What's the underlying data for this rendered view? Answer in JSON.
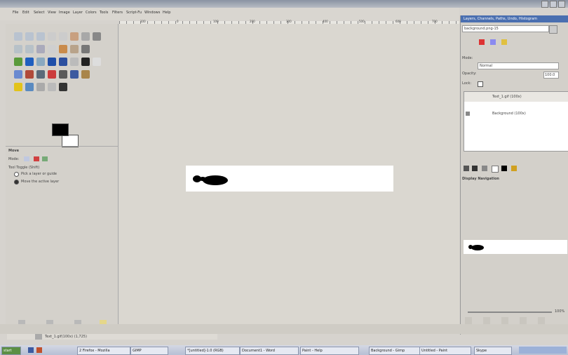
{
  "window": {
    "title": ""
  },
  "menubar": {
    "items": [
      "File",
      "Edit",
      "Select",
      "View",
      "Image",
      "Layer",
      "Colors",
      "Tools",
      "Filters",
      "Script-Fu",
      "Windows",
      "Help"
    ]
  },
  "ruler": {
    "ticks": [
      "100",
      "0",
      "100",
      "200",
      "300",
      "400",
      "500",
      "600",
      "700",
      "800"
    ]
  },
  "toolbox": {
    "options_title": "Move",
    "mode_label": "Mode:",
    "tool_toggle_label": "Tool Toggle (Shift)",
    "option_1": "Pick a layer or guide",
    "option_2": "Move the active layer"
  },
  "dock": {
    "tabs_label": "Layers, Channels, Paths, Undo, Histogram",
    "image_select": "background.png-15",
    "mode_label": "Mode:",
    "mode_value": "Normal",
    "opacity_label": "Opacity:",
    "opacity_value": "100.0",
    "lock_label": "Lock:",
    "layers": [
      {
        "name": "Text_1.gif (100x)"
      },
      {
        "name": "Background (100x)"
      }
    ],
    "navigation_title": "Display Navigation",
    "zoom_value": "100%"
  },
  "statusbar": {
    "tab_label": "Text_1.gif(100x) (1,725)"
  },
  "taskbar": {
    "start_label": "start",
    "items": [
      "2 Firefox - Mozilla",
      "GIMP",
      "*[untitled]-1.0 (RGB)",
      "Document1 - Word",
      "Paint - Help",
      "Background - Gimp",
      "Untitled - Paint",
      "Skype"
    ]
  },
  "colors": {
    "titlebar_start": "#8a93a3",
    "dock_tab": "#4a6fb0",
    "canvas_bg": "#dad7d0"
  }
}
